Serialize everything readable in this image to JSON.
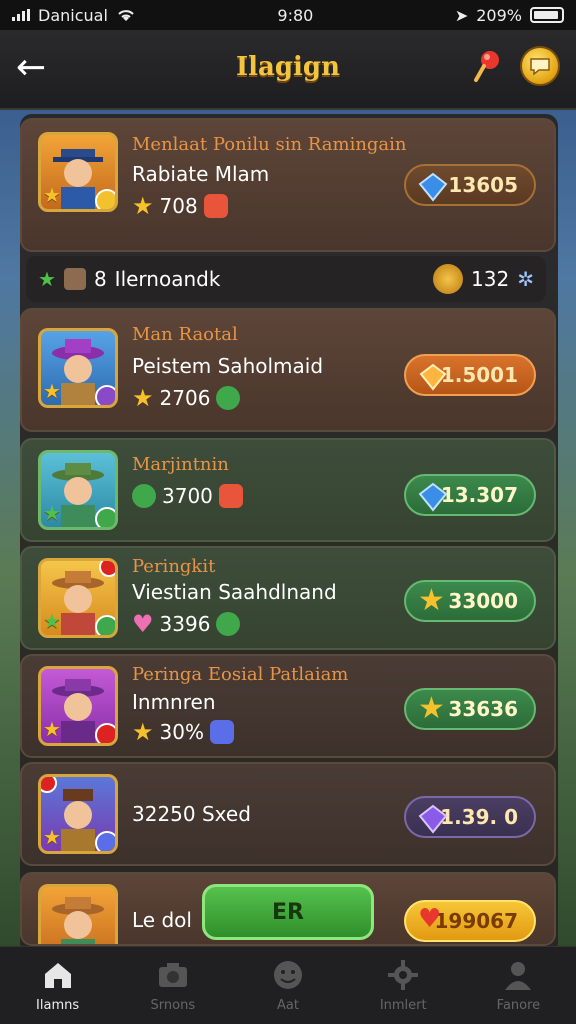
{
  "status": {
    "carrier": "Danicual",
    "time": "9:80",
    "battery": "209%"
  },
  "header": {
    "title": "Ilagign"
  },
  "cards": [
    {
      "subtitle": "Menlaat Ponilu sin Ramingain",
      "name": "Rabiate Mlam",
      "stat": "708",
      "price": "13605",
      "price_style": "brown",
      "gem": "blue"
    },
    {
      "subtitle": "Man Raotal",
      "name": "Peistem Saholmaid",
      "stat": "2706",
      "price": "1.5001",
      "price_style": "orange",
      "gem": "orange"
    },
    {
      "subtitle": "Marjintnin",
      "name": "",
      "stat": "3700",
      "price": "13.307",
      "price_style": "green",
      "gem": "blue"
    },
    {
      "subtitle": "Peringkit",
      "name": "Viestian Saahdlnand",
      "stat": "3396",
      "price": "33000",
      "price_style": "green",
      "gem": "star"
    },
    {
      "subtitle": "Peringa Eosial Patlaiam",
      "name": "Inmnren",
      "stat": "30%",
      "price": "33636",
      "price_style": "green",
      "gem": "star"
    },
    {
      "subtitle": "",
      "name": "32250 Sxed",
      "stat": "",
      "price": "1.39. 0",
      "price_style": "purple",
      "gem": "purple"
    },
    {
      "subtitle": "",
      "name": "Le dol",
      "stat": "",
      "price": "199067",
      "price_style": "gold",
      "gem": "heart"
    }
  ],
  "strip": {
    "count": "8",
    "label": "Ilernoandk",
    "coins": "132"
  },
  "claim": {
    "label": "ER"
  },
  "nav": [
    {
      "label": "Ilamns",
      "icon": "home-icon",
      "active": true
    },
    {
      "label": "Srnons",
      "icon": "camera-icon",
      "active": false
    },
    {
      "label": "Aat",
      "icon": "face-icon",
      "active": false
    },
    {
      "label": "Inmlert",
      "icon": "gear-icon",
      "active": false
    },
    {
      "label": "Fanore",
      "icon": "person-icon",
      "active": false
    }
  ],
  "colors": {
    "title": "#f3c440",
    "accent_orange": "#e79447",
    "green_button": "#3c8a4c",
    "gold_button": "#f6c637"
  }
}
